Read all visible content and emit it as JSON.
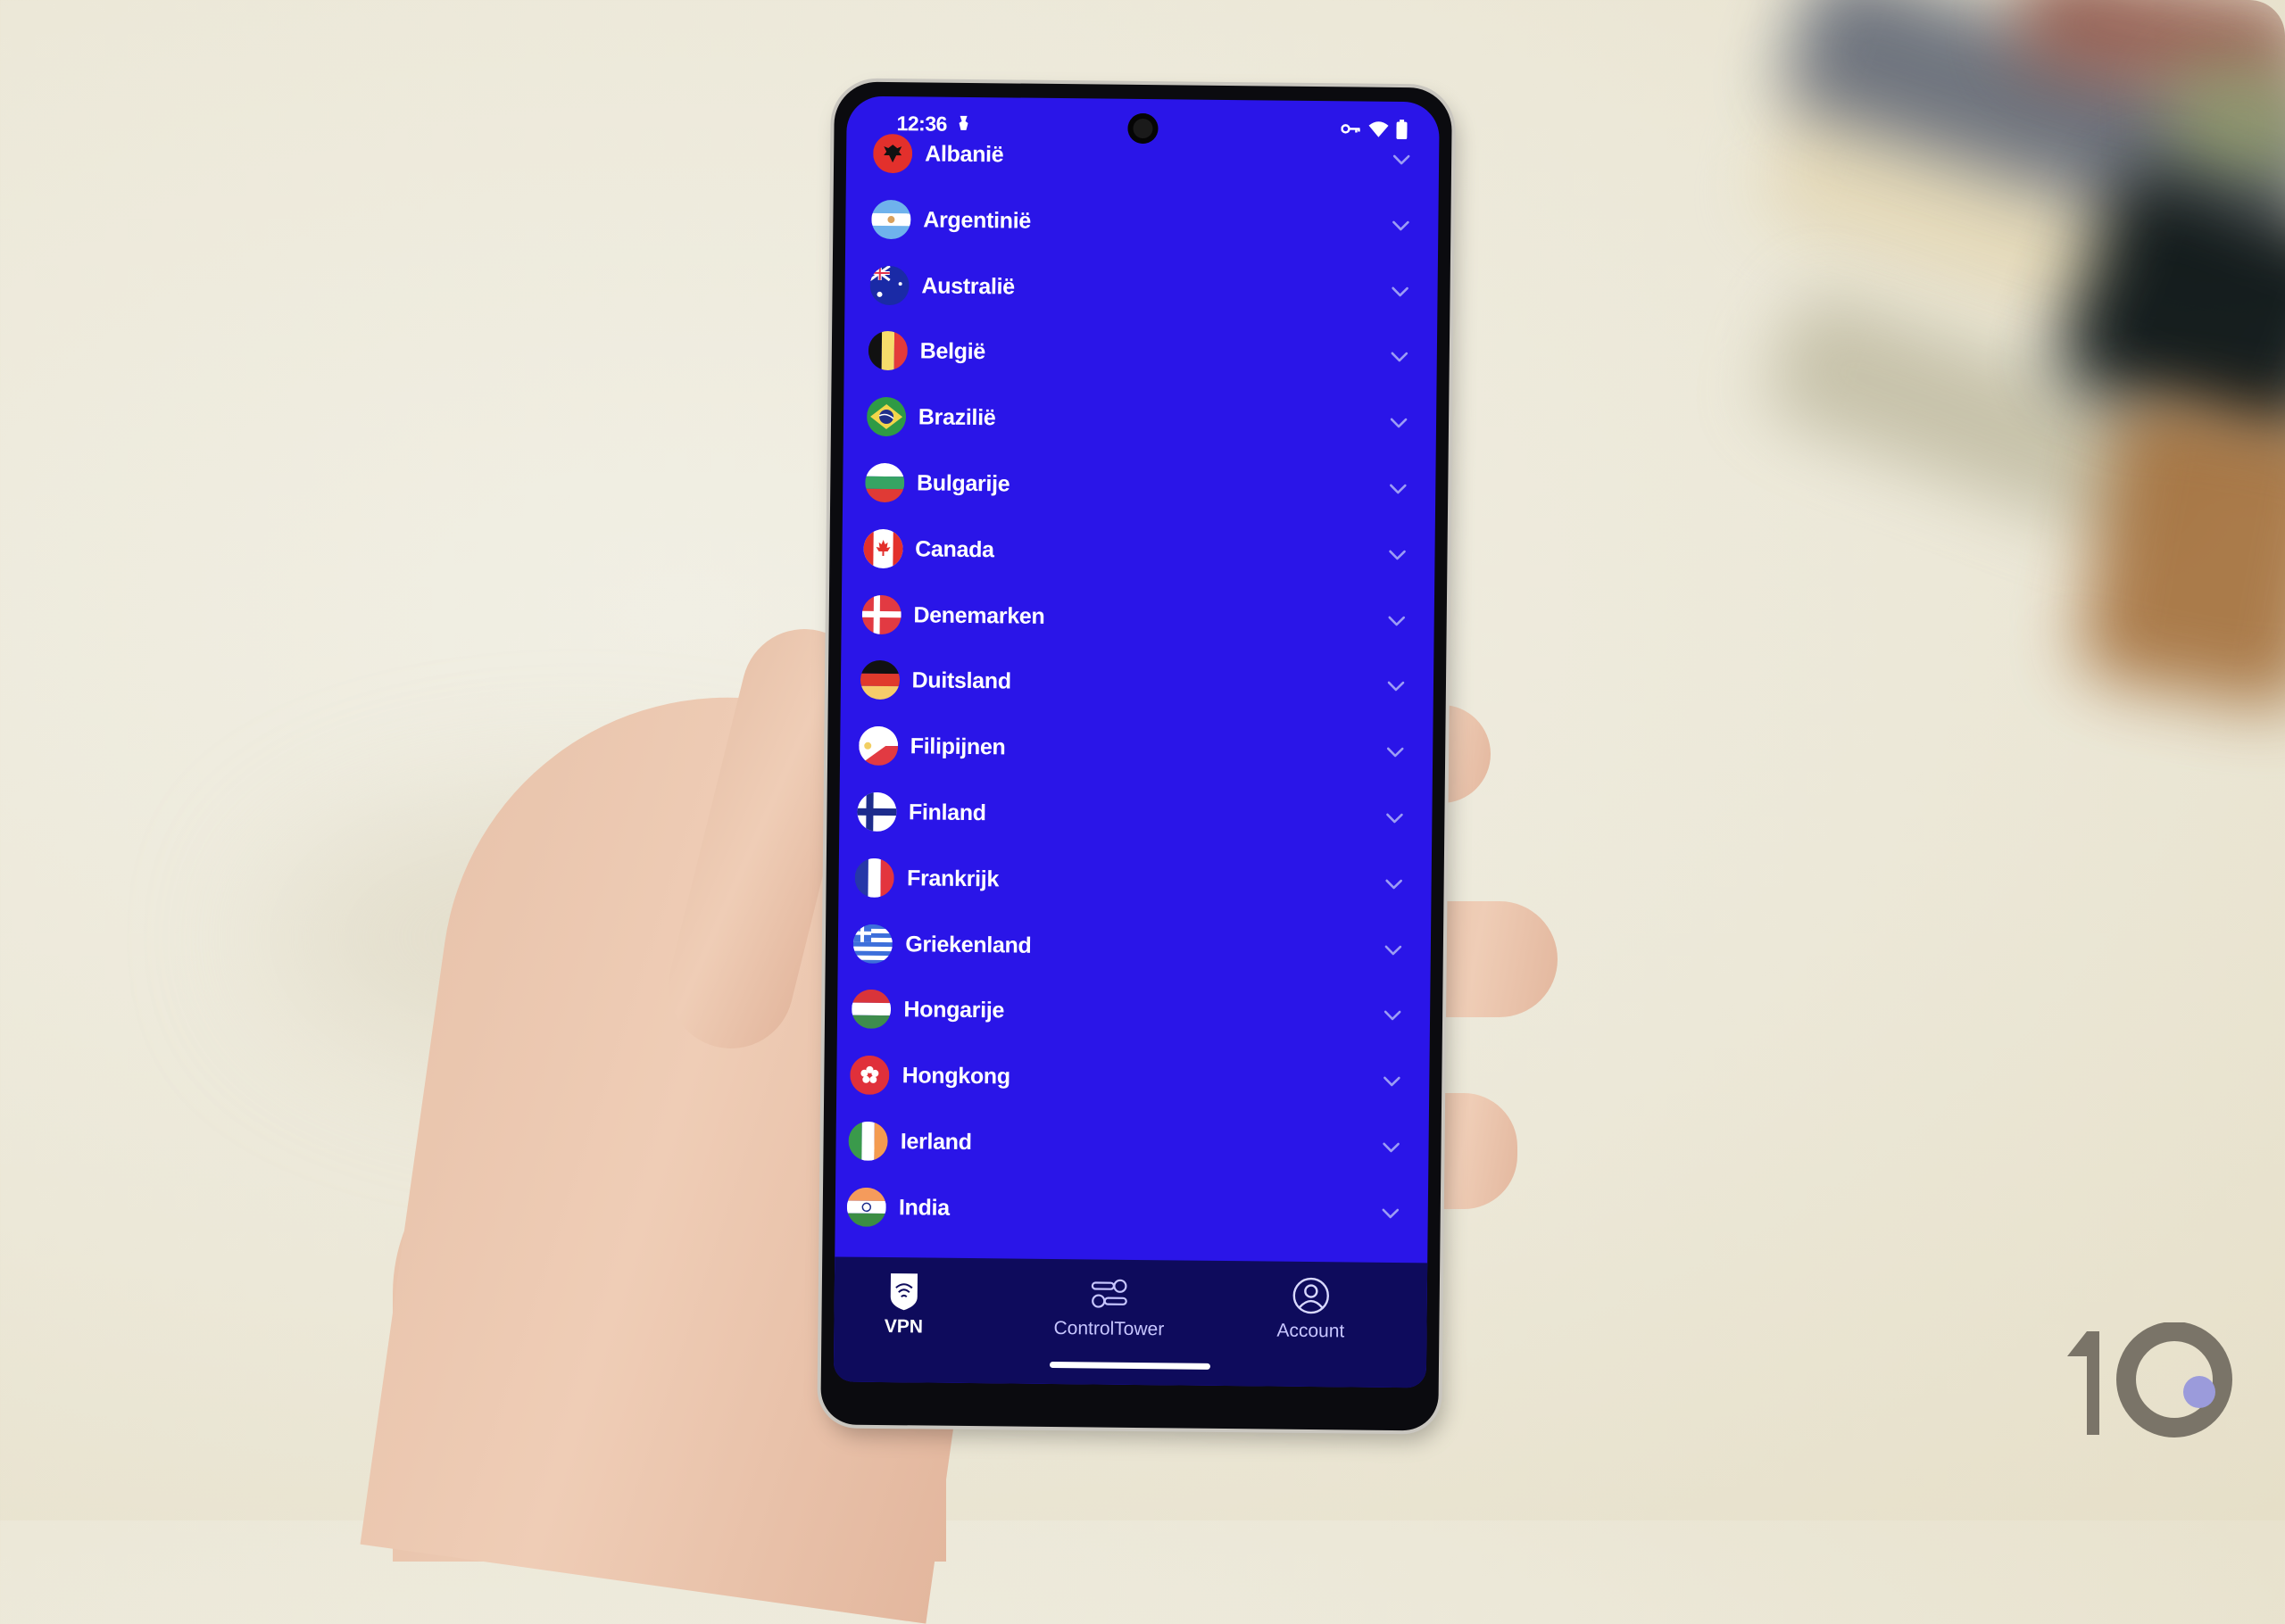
{
  "status_bar": {
    "time": "12:36",
    "icons": [
      "notification-icon",
      "vpn-key-icon",
      "wifi-icon",
      "battery-icon"
    ]
  },
  "country_list": [
    {
      "name": "Albanië",
      "flag": "albania-flag-icon"
    },
    {
      "name": "Argentinië",
      "flag": "argentina-flag-icon"
    },
    {
      "name": "Australië",
      "flag": "australia-flag-icon"
    },
    {
      "name": "België",
      "flag": "belgium-flag-icon"
    },
    {
      "name": "Brazilië",
      "flag": "brazil-flag-icon"
    },
    {
      "name": "Bulgarije",
      "flag": "bulgaria-flag-icon"
    },
    {
      "name": "Canada",
      "flag": "canada-flag-icon"
    },
    {
      "name": "Denemarken",
      "flag": "denmark-flag-icon"
    },
    {
      "name": "Duitsland",
      "flag": "germany-flag-icon"
    },
    {
      "name": "Filipijnen",
      "flag": "philippines-flag-icon"
    },
    {
      "name": "Finland",
      "flag": "finland-flag-icon"
    },
    {
      "name": "Frankrijk",
      "flag": "france-flag-icon"
    },
    {
      "name": "Griekenland",
      "flag": "greece-flag-icon"
    },
    {
      "name": "Hongarije",
      "flag": "hungary-flag-icon"
    },
    {
      "name": "Hongkong",
      "flag": "hongkong-flag-icon"
    },
    {
      "name": "Ierland",
      "flag": "ireland-flag-icon"
    },
    {
      "name": "India",
      "flag": "india-flag-icon"
    }
  ],
  "bottom_nav": {
    "items": [
      {
        "label": "VPN",
        "icon": "vpn-shield-icon",
        "active": true
      },
      {
        "label": "ControlTower",
        "icon": "sliders-icon",
        "active": false
      },
      {
        "label": "Account",
        "icon": "account-icon",
        "active": false
      }
    ]
  },
  "colors": {
    "screen_bg": "#2A15E8",
    "nav_bg": "#0E0B5C",
    "chevron": "#9C9CF5",
    "watermark_gray": "#7A7468",
    "watermark_dot": "#9B9BDB"
  },
  "watermark": {
    "text": "10"
  }
}
